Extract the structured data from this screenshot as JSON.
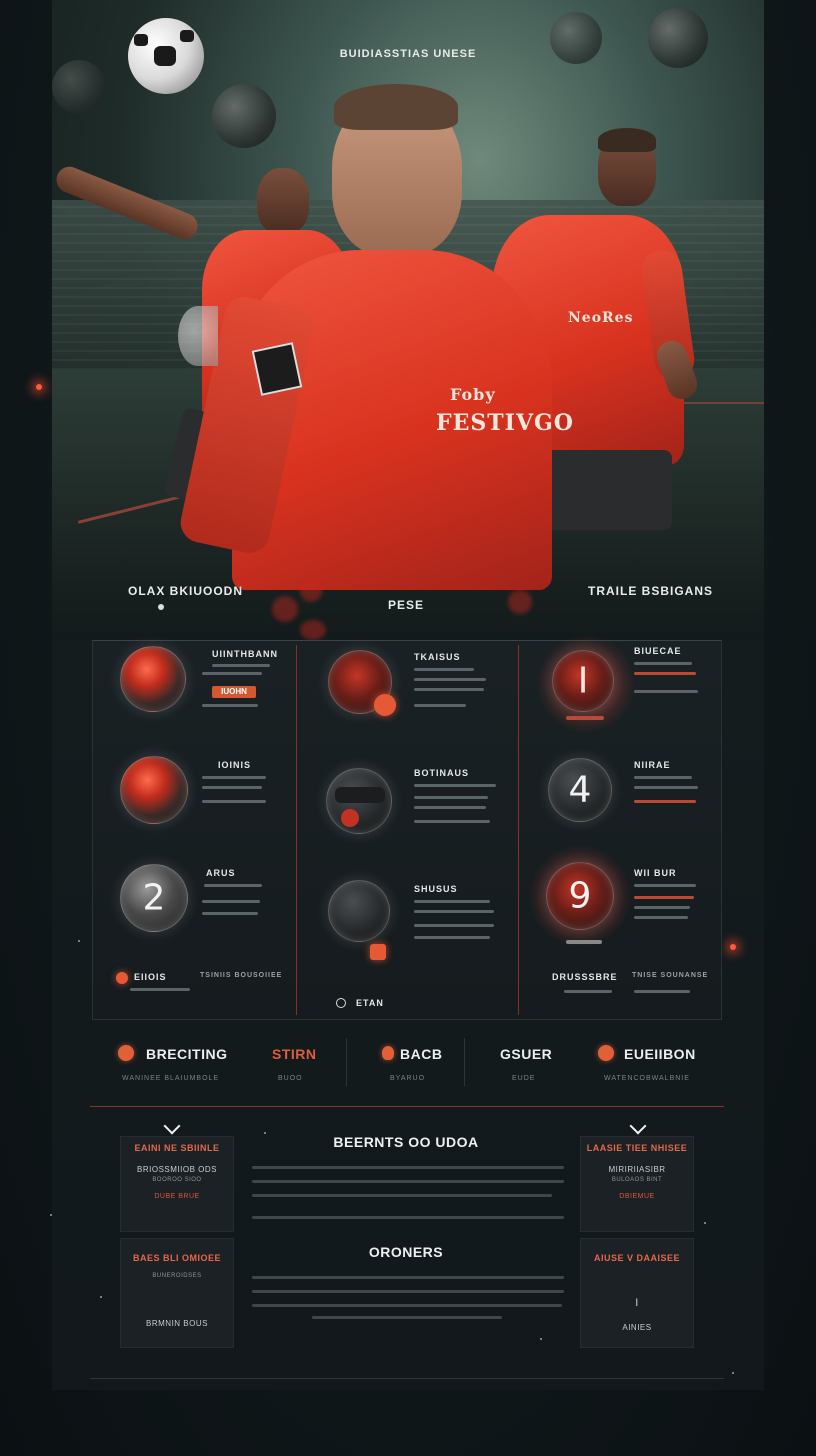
{
  "hero": {
    "top_text": "BUIDIASSTIAS UNESE",
    "left_label": "OLAX BKIUOODN",
    "center_label": "PESE",
    "right_label": "TRAILE BSBIGANS",
    "jersey_center_line1": "Foby",
    "jersey_center_line2": "FESTIVGO"
  },
  "cards": {
    "left": [
      {
        "title": "UIINTHBANN",
        "badge": "IUOHN",
        "icon": "red-ball-icon"
      },
      {
        "title": "IOINIS",
        "icon": "red-ball-icon"
      },
      {
        "title": "ARUS",
        "number": "2",
        "icon": "number-orb"
      }
    ],
    "center": [
      {
        "title": "TKAISUS",
        "icon": "dark-ball-icon"
      },
      {
        "title": "BOTINAUS",
        "icon": "helmet-ball-icon"
      },
      {
        "title": "SHUSUS",
        "icon": "dark-ball-icon"
      }
    ],
    "right": [
      {
        "title": "BIUECAE",
        "number": "I",
        "icon": "number-orb"
      },
      {
        "title": "NIIRAE",
        "number": "4",
        "icon": "number-orb"
      },
      {
        "title": "WII BUR",
        "number": "9",
        "icon": "number-orb"
      }
    ],
    "footer_left_title": "EIIOIS",
    "footer_left_sub": "TSINIIS BOUSOIIEE",
    "footer_center": "ETAN",
    "footer_right_title": "DRUSSSBRE",
    "footer_right_sub": "TNISE SOUNANSE"
  },
  "stats": [
    {
      "title": "BRECITING",
      "sub": "WANINEE BLAIUMBOLE",
      "has_icon": true,
      "accent": false
    },
    {
      "title": "STIRN",
      "sub": "BUOO",
      "has_icon": false,
      "accent": true
    },
    {
      "title": "BACB",
      "sub": "BYARUO",
      "has_icon": true,
      "accent": false
    },
    {
      "title": "GSUER",
      "sub": "EUDE",
      "has_icon": false,
      "accent": false
    },
    {
      "title": "EUEIIBON",
      "sub": "WATENCOBWALBNIE",
      "has_icon": true,
      "accent": false
    }
  ],
  "bottom": {
    "section1_title": "BEERNTS OO UDOA",
    "section2_title": "ORONERS",
    "left_panel_top": {
      "title": "EAINI NE SBIINLE",
      "text": "BRIOSSMIIOB ODS",
      "sub": "BOOROO SIOO",
      "tag": "DUBE BRUE"
    },
    "left_panel_bottom": {
      "title": "BAES BLI OMIOEE",
      "sub": "BUNEROIDSES",
      "footer": "BRMNIN BOUS"
    },
    "right_panel_top": {
      "title": "LAASIE TIEE NHISEE",
      "text": "MIRIRIIASIBR",
      "sub": "BULOAOS BINT",
      "tag": "DBIEMUE"
    },
    "right_panel_bottom": {
      "title": "AIUSE V DAAISEE",
      "number": "I",
      "footer": "AINIES"
    }
  },
  "colors": {
    "accent": "#e25b3e",
    "jersey": "#d8321f",
    "bg": "#0d1316"
  }
}
